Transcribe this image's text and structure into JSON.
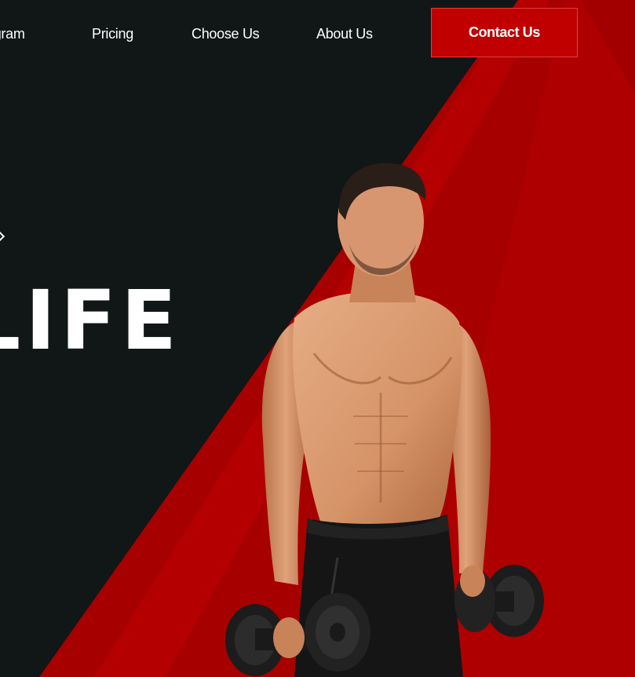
{
  "nav": {
    "items": [
      {
        "label": "ogram"
      },
      {
        "label": "Pricing"
      },
      {
        "label": "Choose Us"
      },
      {
        "label": "About Us"
      }
    ],
    "cta_label": "Contact Us"
  },
  "hero": {
    "headline_fragment": "LIFE"
  },
  "colors": {
    "background_dark": "#111617",
    "accent_red": "#c00000",
    "deep_red": "#a50000",
    "text": "#ffffff"
  },
  "images": {
    "athlete": "shirtless muscular man holding two dumbbells"
  }
}
